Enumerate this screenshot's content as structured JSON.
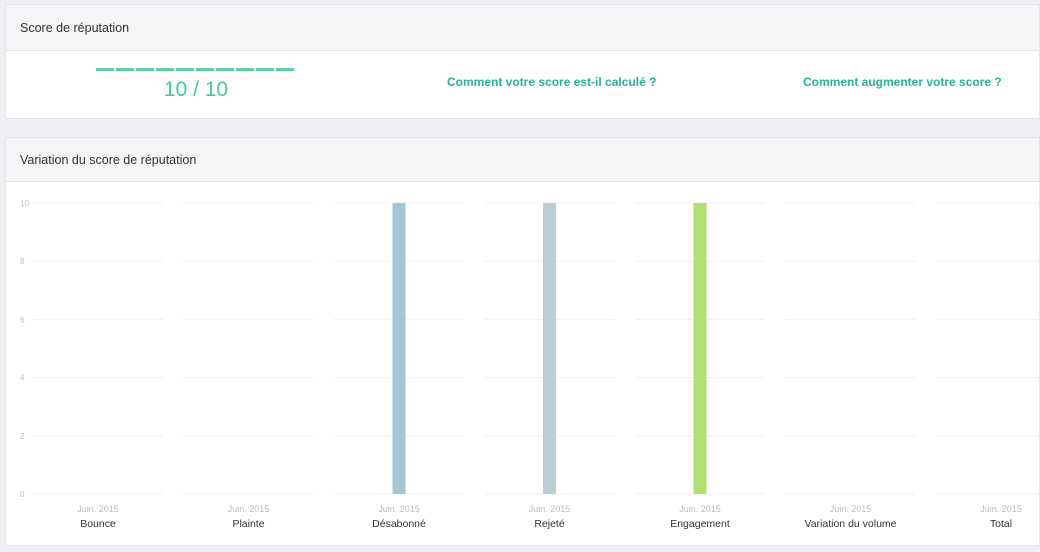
{
  "score_panel": {
    "title": "Score de réputation",
    "score_text": "10 / 10",
    "score_value": 10,
    "score_max": 10,
    "link_calc": "Comment votre score est-il calculé ?",
    "link_improve": "Comment augmenter votre score ?"
  },
  "variation_panel": {
    "title": "Variation du score de réputation"
  },
  "colors": {
    "accent": "#25b39a",
    "score_green": "#5ed0a0"
  },
  "chart_data": {
    "type": "bar",
    "ylim": [
      0,
      10
    ],
    "yticks": [
      0,
      2,
      4,
      6,
      8,
      10
    ],
    "grid": true,
    "panels": [
      {
        "name": "Bounce",
        "x": "Juin. 2015",
        "value": 0,
        "color": "#a7c8d6"
      },
      {
        "name": "Plainte",
        "x": "Juin. 2015",
        "value": 0,
        "color": "#a7c8d6"
      },
      {
        "name": "Désabonné",
        "x": "Juin. 2015",
        "value": 10,
        "color": "#a2c6d4"
      },
      {
        "name": "Rejeté",
        "x": "Juin. 2015",
        "value": 10,
        "color": "#bccdd5"
      },
      {
        "name": "Engagement",
        "x": "Juin. 2015",
        "value": 10,
        "color": "#b1e070"
      },
      {
        "name": "Variation du volume",
        "x": "Juin. 2015",
        "value": 0,
        "color": "#a7c8d6"
      },
      {
        "name": "Total",
        "x": "Juin. 2015",
        "value": 0,
        "color": "#a7c8d6"
      }
    ]
  }
}
